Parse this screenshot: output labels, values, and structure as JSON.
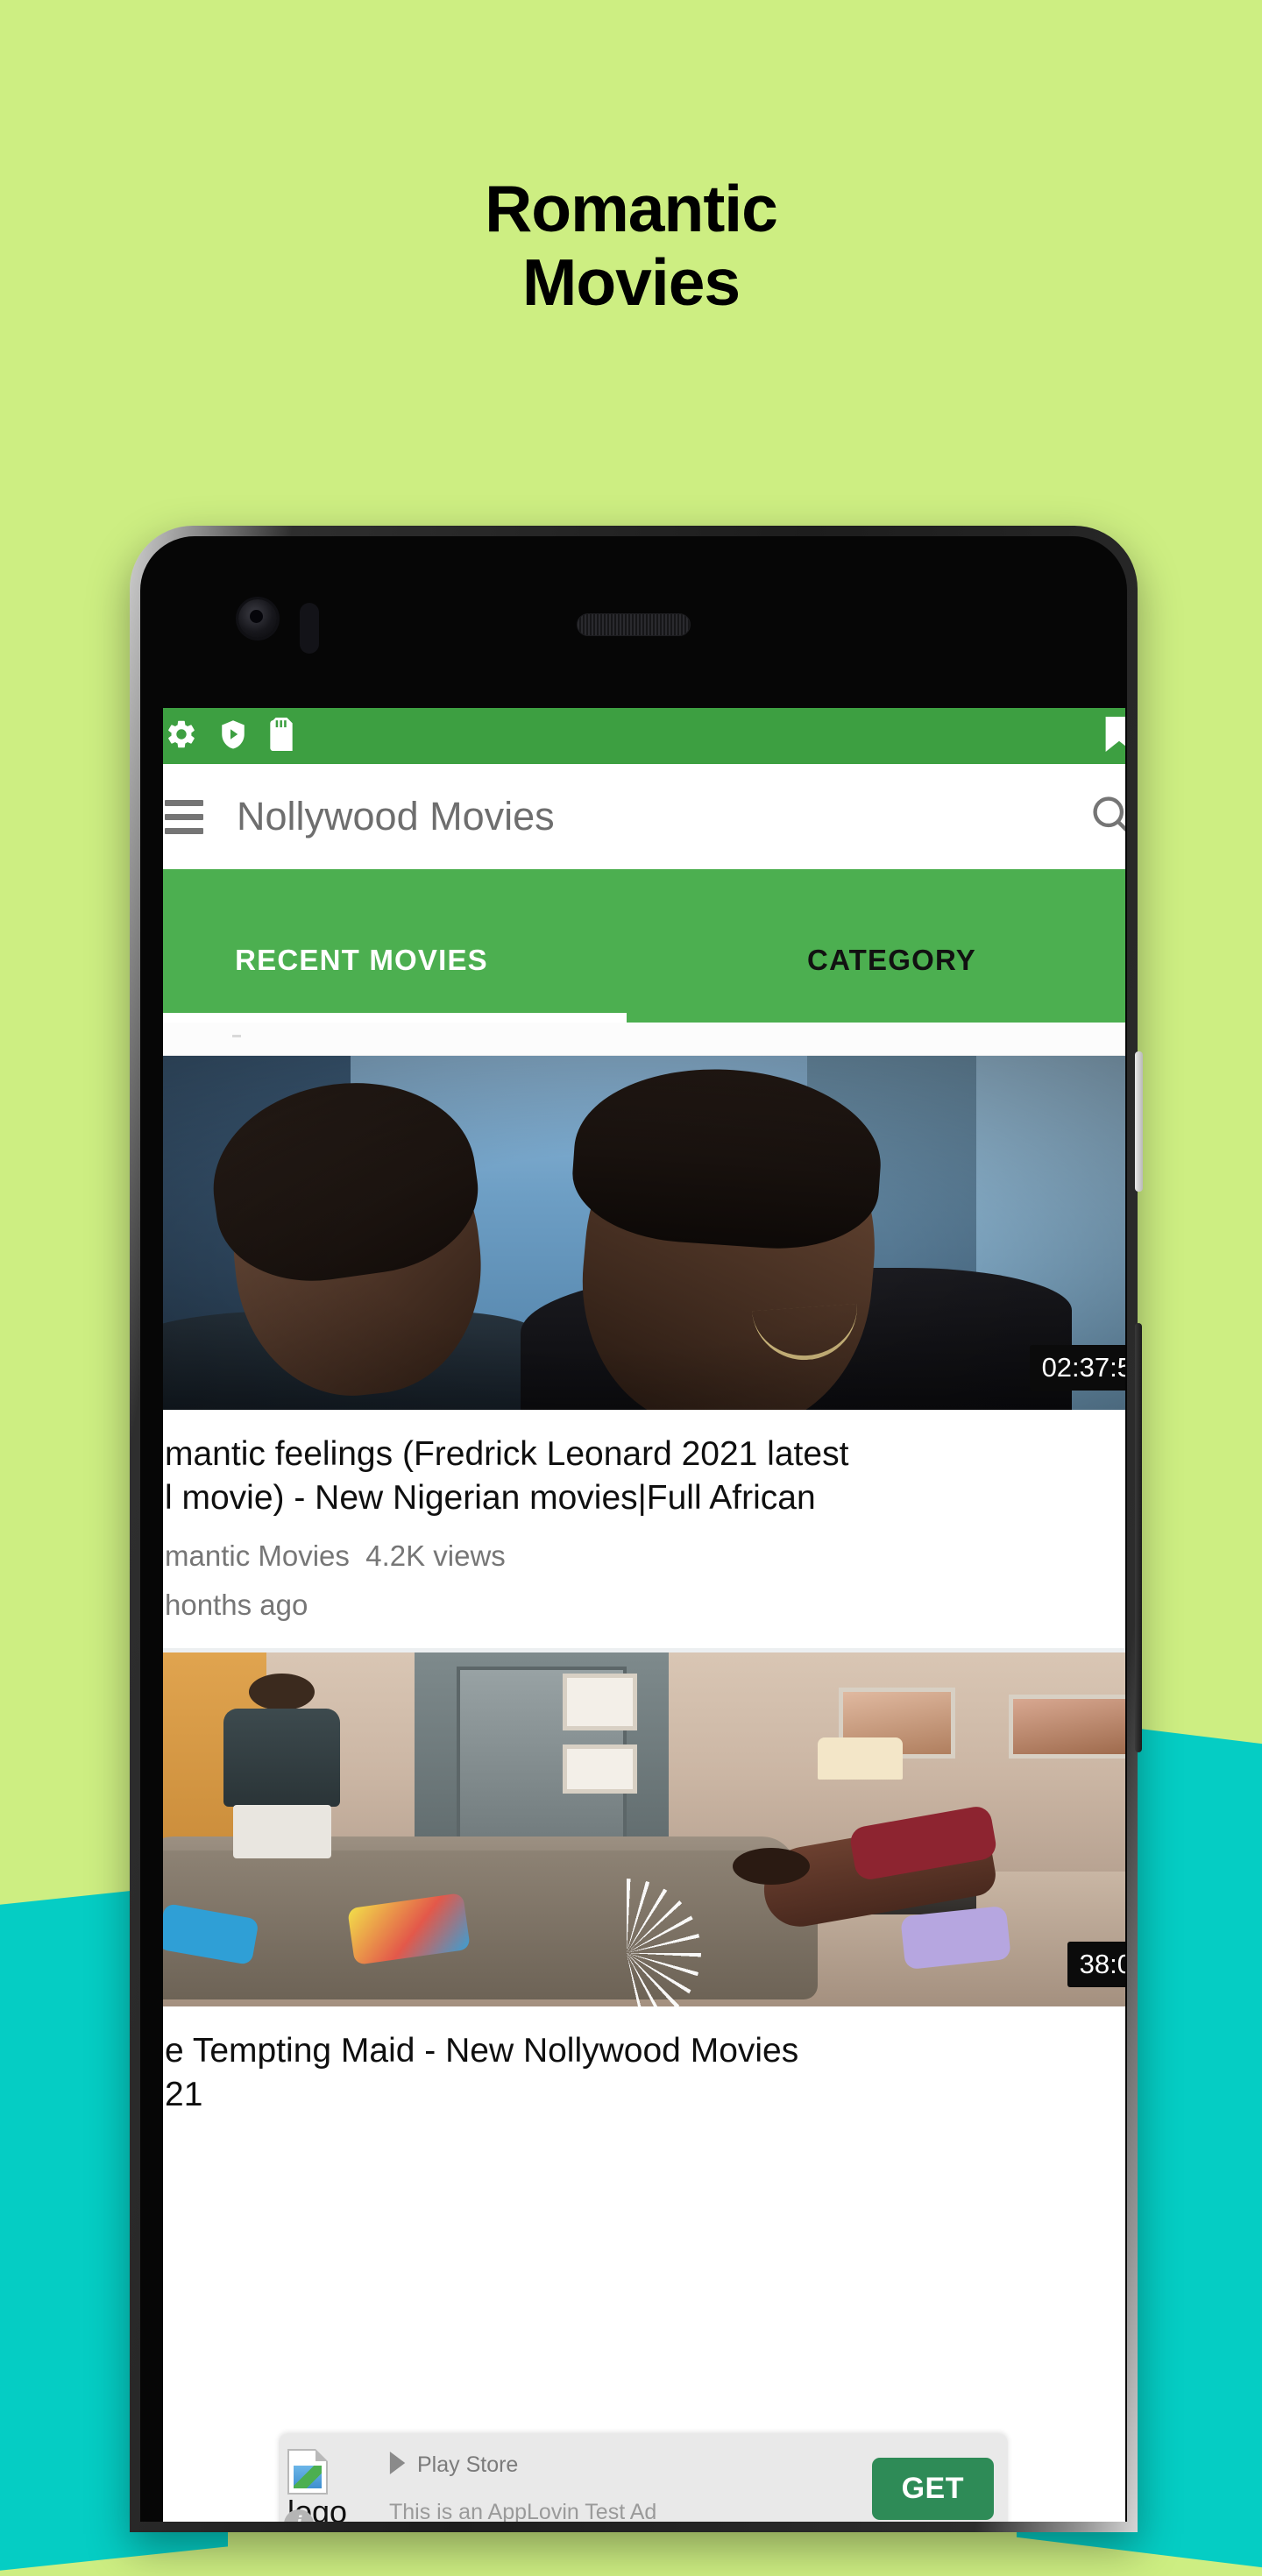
{
  "poster": {
    "headline_line1": "Romantic",
    "headline_line2": "Movies",
    "bg_color": "#CDEE82",
    "accent_color": "#05CDC4"
  },
  "device": {
    "frame_name": "android-phone-frame",
    "camera": "front-camera",
    "speaker": "earpiece-speaker",
    "power_button": "power-button",
    "volume_button": "volume-rocker"
  },
  "statusbar": {
    "background": "#3D9F41",
    "icons_left": [
      "gear-icon",
      "play-protect-shield-icon",
      "sd-card-icon"
    ],
    "icons_right": [
      "tag-icon"
    ]
  },
  "appbar": {
    "menu_icon": "hamburger-menu-icon",
    "title": "Nollywood Movies",
    "search_icon": "search-icon",
    "background": "#FFFFFF",
    "title_color": "#6E6E6E"
  },
  "tabs": {
    "background": "#4CAF50",
    "items": [
      {
        "label": "RECENT MOVIES",
        "active": true
      },
      {
        "label": "CATEGORY",
        "active": false
      }
    ]
  },
  "videos": [
    {
      "title": "mantic feelings (Fredrick Leonard 2021 latest",
      "title_line2": "l movie) - New Nigerian movies|Full African",
      "channel": "mantic Movies",
      "views": "4.2K views",
      "published": "honths ago",
      "duration": "02:37:5",
      "thumbnail": "couple-embracing-thumbnail"
    },
    {
      "title": "e Tempting Maid - New Nollywood Movies",
      "title_line2": "21",
      "channel": "",
      "views": "",
      "published": "",
      "duration": "38:0",
      "thumbnail": "living-room-scene-thumbnail"
    }
  ],
  "ad": {
    "logo_label": "logo",
    "logo_icon": "broken-image-icon",
    "info_icon": "info-icon",
    "store_icon": "play-store-triangle-icon",
    "store_name": "Play Store",
    "tagline": "This is an AppLovin Test Ad",
    "cta_label": "GET",
    "cta_color": "#2E8B57"
  }
}
